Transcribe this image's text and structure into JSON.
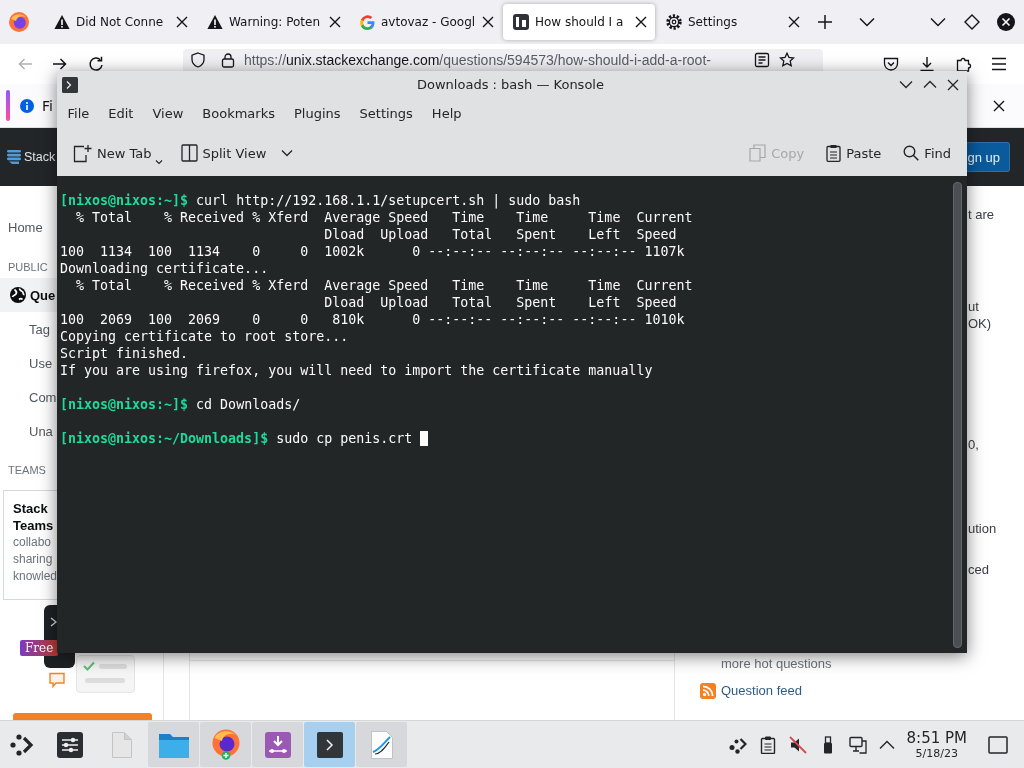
{
  "browser": {
    "tabs": [
      {
        "title": "Did Not Conne",
        "selected": false
      },
      {
        "title": "Warning: Poten",
        "selected": false
      },
      {
        "title": "avtovaz - Googl",
        "selected": false
      },
      {
        "title": "How should I a",
        "selected": true
      },
      {
        "title": "Settings",
        "selected": false
      }
    ],
    "navigation": {
      "back": {
        "disabled": true
      },
      "forward": {
        "disabled": false
      },
      "url": {
        "scheme": "https://",
        "domain": "unix.stackexchange.com",
        "path": "/questions/594573/how-should-i-add-a-root-"
      }
    },
    "notification": {
      "text": "Fi"
    }
  },
  "site": {
    "header": {
      "logo_text": "Stack",
      "signup_label": "gn up"
    },
    "sidebar": {
      "items": [
        {
          "label": "Home",
          "selected": false
        }
      ],
      "public_heading": "PUBLIC",
      "public_items": [
        {
          "label": "Que",
          "selected": true
        },
        {
          "label": "Tag",
          "selected": false
        },
        {
          "label": "Use",
          "selected": false
        },
        {
          "label": "Com",
          "selected": false
        },
        {
          "label": "Una",
          "selected": false
        }
      ],
      "teams_heading": "TEAMS",
      "teams_card": {
        "title_lines": [
          "Stack",
          "Teams"
        ],
        "text_lines": [
          "collabo",
          "sharing",
          "knowled"
        ],
        "badge": "Free"
      }
    },
    "right_sidebar": {
      "fragments": [
        "t are",
        "ut",
        "OK)",
        "0,",
        "ution",
        "ced"
      ],
      "hot_questions_link": "more hot questions",
      "feed_link": "Question feed"
    }
  },
  "konsole": {
    "title": "Downloads : bash — Konsole",
    "menu": [
      "File",
      "Edit",
      "View",
      "Bookmarks",
      "Plugins",
      "Settings",
      "Help"
    ],
    "toolbar_left": [
      {
        "label": "New Tab",
        "disabled": false
      },
      {
        "label": "Split View",
        "disabled": false
      }
    ],
    "toolbar_right": [
      {
        "label": "Copy",
        "disabled": true
      },
      {
        "label": "Paste",
        "disabled": false
      },
      {
        "label": "Find",
        "disabled": false
      }
    ],
    "terminal": {
      "cursor_visible": true,
      "blocks": [
        {
          "lines": [
            {
              "kind": "command",
              "prompt": "[nixos@nixos:~]$",
              "command": "curl http://192.168.1.1/setupcert.sh | sudo bash"
            },
            {
              "kind": "output",
              "text": "  % Total    % Received % Xferd  Average Speed   Time    Time     Time  Current"
            },
            {
              "kind": "output",
              "text": "                                 Dload  Upload   Total   Spent    Left  Speed"
            },
            {
              "kind": "output",
              "text": "100  1134  100  1134    0     0  1002k      0 --:--:-- --:--:-- --:--:-- 1107k"
            },
            {
              "kind": "output",
              "text": "Downloading certificate..."
            },
            {
              "kind": "output",
              "text": "  % Total    % Received % Xferd  Average Speed   Time    Time     Time  Current"
            },
            {
              "kind": "output",
              "text": "                                 Dload  Upload   Total   Spent    Left  Speed"
            },
            {
              "kind": "output",
              "text": "100  2069  100  2069    0     0   810k      0 --:--:-- --:--:-- --:--:-- 1010k"
            },
            {
              "kind": "output",
              "text": "Copying certificate to root store..."
            },
            {
              "kind": "output",
              "text": "Script finished."
            },
            {
              "kind": "output",
              "text": "If you are using firefox, you will need to import the certificate manually"
            }
          ]
        },
        {
          "lines": [
            {
              "kind": "command",
              "prompt": "[nixos@nixos:~]$",
              "command": "cd Downloads/"
            }
          ]
        },
        {
          "lines": [
            {
              "kind": "command",
              "prompt": "[nixos@nixos:~/Downloads]$",
              "command": "sudo cp penis.crt"
            }
          ]
        }
      ]
    }
  },
  "taskbar": {
    "tasks": [
      {
        "running": false,
        "selected": false
      },
      {
        "running": false,
        "selected": false
      },
      {
        "running": true,
        "selected": false
      },
      {
        "running": true,
        "selected": false
      },
      {
        "running": true,
        "selected": false
      },
      {
        "running": true,
        "selected": true
      },
      {
        "running": true,
        "selected": false
      }
    ],
    "tray": {
      "volume_muted": true
    },
    "clock": {
      "time": "8:51 PM",
      "date": "5/18/23"
    }
  }
}
